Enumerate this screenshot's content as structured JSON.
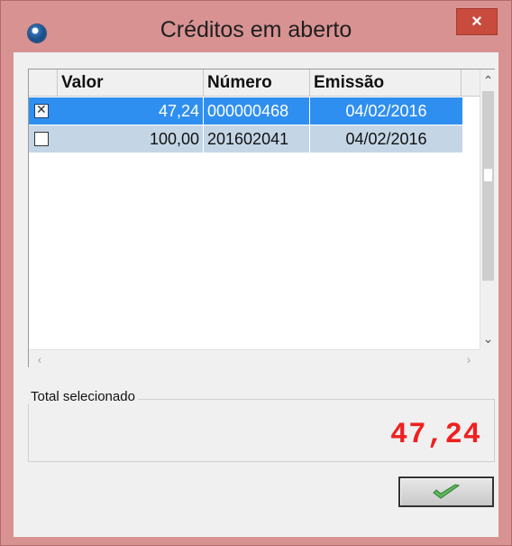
{
  "window": {
    "title": "Créditos em aberto",
    "close_label": "×"
  },
  "grid": {
    "columns": [
      "Valor",
      "Número",
      "Emissão"
    ],
    "rows": [
      {
        "checked": true,
        "valor": "47,24",
        "numero": "000000468",
        "emissao": "04/02/2016"
      },
      {
        "checked": false,
        "valor": "100,00",
        "numero": "201602041",
        "emissao": "04/02/2016"
      }
    ]
  },
  "total": {
    "label": "Total selecionado",
    "value": "47,24"
  },
  "colors": {
    "window_frame": "#d89292",
    "selection": "#2f8ff0",
    "alt_row": "#c4d6e6",
    "total_text": "#f02020",
    "close": "#c84b3d"
  },
  "icons": {
    "app": "app-globe-icon",
    "ok": "checkmark-icon"
  }
}
